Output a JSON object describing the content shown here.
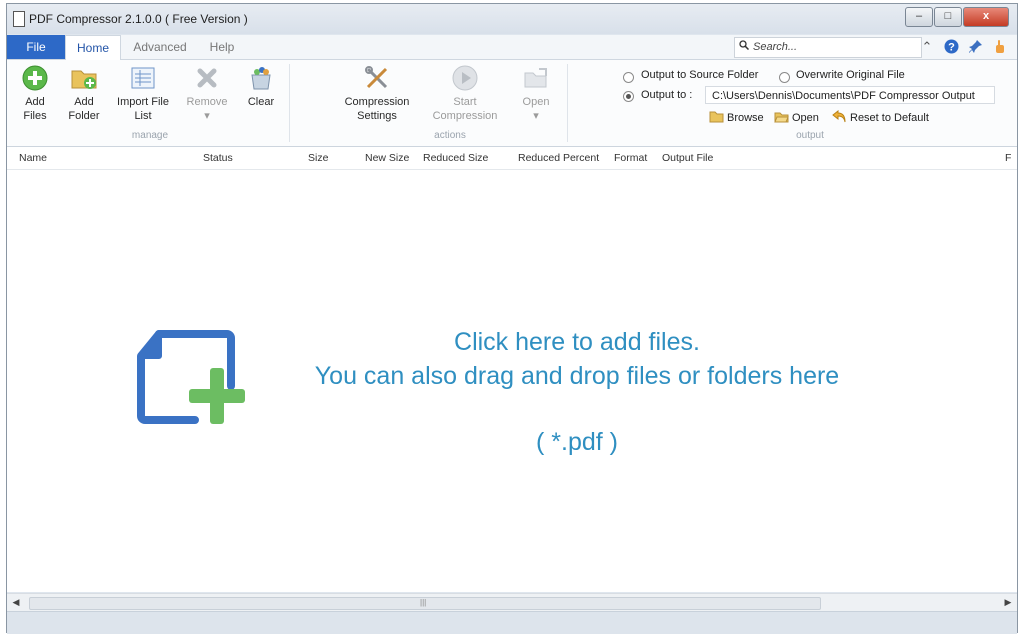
{
  "window": {
    "title": "PDF Compressor 2.1.0.0 ( Free Version )",
    "controls": {
      "minimize": "–",
      "maximize": "□",
      "close": "x"
    }
  },
  "menu": {
    "tabs": {
      "file": "File",
      "home": "Home",
      "advanced": "Advanced",
      "help": "Help"
    },
    "search_placeholder": "Search..."
  },
  "ribbon": {
    "manage": {
      "label": "manage",
      "add_files": {
        "line1": "Add",
        "line2": "Files"
      },
      "add_folder": {
        "line1": "Add",
        "line2": "Folder"
      },
      "import_file_list": {
        "line1": "Import File",
        "line2": "List"
      },
      "remove": {
        "line1": "Remove",
        "line2": "▾"
      },
      "clear": {
        "line1": "Clear"
      }
    },
    "actions": {
      "label": "actions",
      "compression_settings": {
        "line1": "Compression",
        "line2": "Settings"
      },
      "start_compression": {
        "line1": "Start",
        "line2": "Compression"
      },
      "open": {
        "line1": "Open",
        "line2": "▾"
      }
    },
    "output": {
      "label": "output",
      "output_to_source": "Output to Source Folder",
      "overwrite_original": "Overwrite Original File",
      "output_to_label": "Output to :",
      "output_path": "C:\\Users\\Dennis\\Documents\\PDF Compressor Output",
      "browse": "Browse",
      "open": "Open",
      "reset": "Reset to Default"
    }
  },
  "table": {
    "columns": [
      "Name",
      "Status",
      "Size",
      "New Size",
      "Reduced Size",
      "Reduced Percent",
      "Format",
      "Output File",
      "F"
    ]
  },
  "drop_zone": {
    "line1": "Click here to add files.",
    "line2": "You can also drag and drop files or folders here",
    "filter": "( *.pdf )"
  },
  "colors": {
    "accent": "#2f8fc1",
    "file_tab": "#2d69c7",
    "doc_icon_blue": "#3a72c4",
    "plus_green": "#6cbd62"
  },
  "icons": [
    "add-file-icon",
    "add-folder-icon",
    "import-list-icon",
    "remove-icon",
    "clear-icon",
    "compression-settings-icon",
    "start-icon",
    "open-icon",
    "browse-icon",
    "open-folder-icon",
    "reset-icon",
    "search-icon",
    "help-icon",
    "pin-icon",
    "hand-icon"
  ]
}
